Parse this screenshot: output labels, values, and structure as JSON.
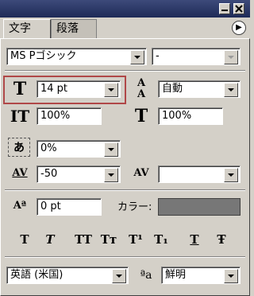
{
  "tabs": [
    {
      "label": "文字",
      "active": true
    },
    {
      "label": "段落",
      "active": false
    }
  ],
  "font": {
    "family": "MS Pゴシック",
    "style": "-",
    "size": "14 pt",
    "leading": "自動",
    "vertical_scale": "100%",
    "horizontal_scale": "100%",
    "tsume": "0%",
    "kerning": "-50",
    "tracking": "",
    "baseline_shift": "0 pt"
  },
  "labels": {
    "color": "カラー:"
  },
  "icons": {
    "size": "T",
    "leading": "A",
    "vscale": "IT",
    "hscale": "T",
    "tsume": "あ",
    "kerning": "AV",
    "tracking": "AV",
    "baseline": "Aª",
    "aa": "ªa"
  },
  "style_buttons": [
    "T",
    "T",
    "TT",
    "Tт",
    "T¹",
    "T₁",
    "T",
    "Ŧ"
  ],
  "language": "英語 (米国)",
  "antialias": "鮮明",
  "colors": {
    "text_color_swatch": "#777777",
    "highlight": "#b04848"
  }
}
